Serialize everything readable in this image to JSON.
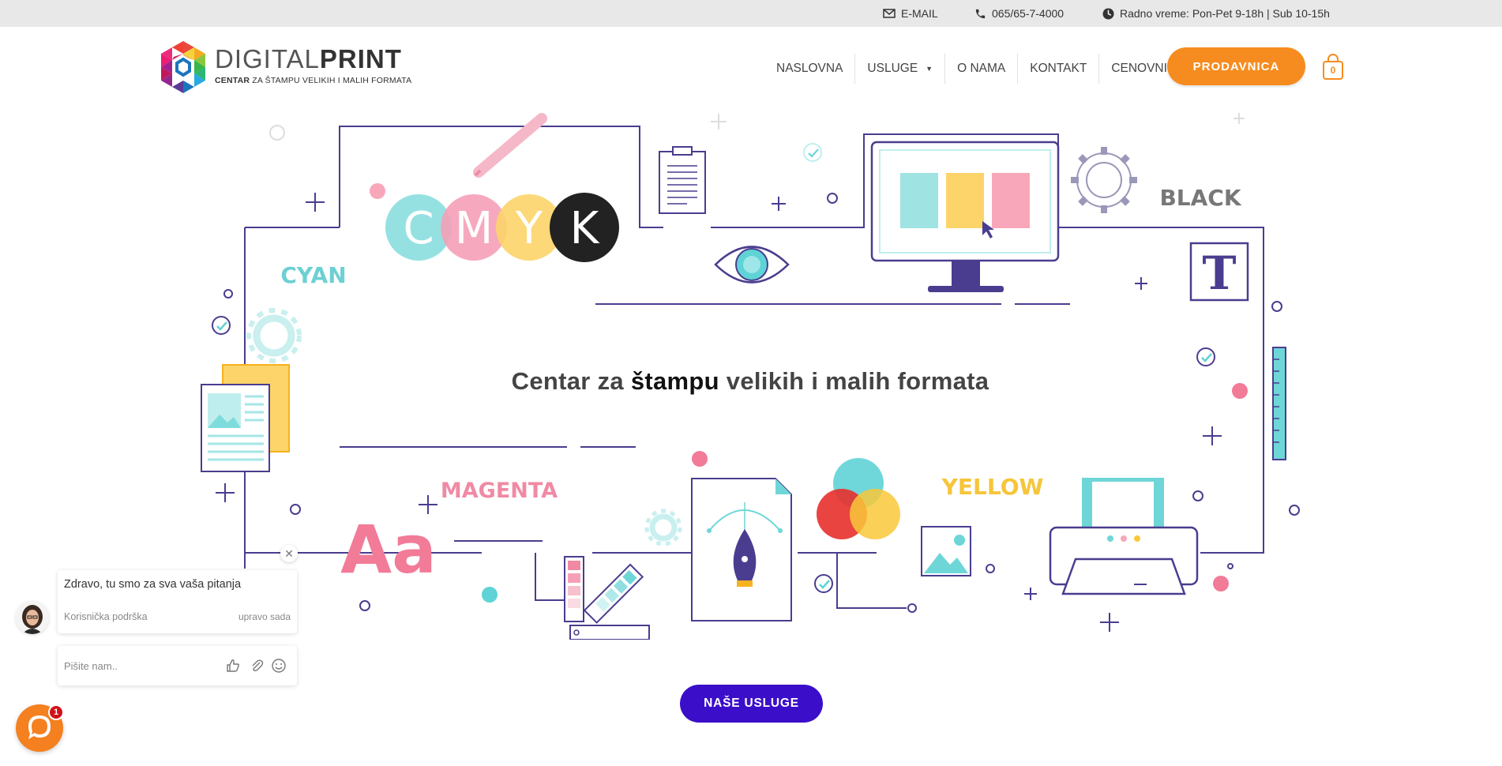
{
  "topbar": {
    "email_label": "E-MAIL",
    "phone_label": "065/65-7-4000",
    "hours_label": "Radno vreme: Pon-Pet 9-18h | Sub 10-15h"
  },
  "logo": {
    "name_light": "DIGITAL",
    "name_bold": "PRINT",
    "tagline_bold": "CENTAR",
    "tagline_rest": " ZA ŠTAMPU VELIKIH I MALIH FORMATA"
  },
  "nav": {
    "items": [
      {
        "label": "NASLOVNA"
      },
      {
        "label": "USLUGE"
      },
      {
        "label": "O NAMA"
      },
      {
        "label": "KONTAKT"
      },
      {
        "label": "CENOVNIK"
      }
    ],
    "shop_label": "PRODAVNICA",
    "cart_count": "0"
  },
  "hero": {
    "title_pre": "Centar za ",
    "title_bold": "štampu",
    "title_post": " velikih i malih formata",
    "cmyk_letters": [
      "C",
      "M",
      "Y",
      "K"
    ],
    "label_cyan": "CYAN",
    "label_magenta": "MAGENTA",
    "label_yellow": "YELLOW",
    "label_black": "BLACK",
    "typeface_sample": "Aa",
    "type_tool": "T",
    "cta_label": "NAŠE USLUGE"
  },
  "chat": {
    "greeting": "Zdravo, tu smo za sva vaša pitanja",
    "agent_label": "Korisnička podrška",
    "time_label": "upravo sada",
    "input_placeholder": "Pišite nam..",
    "badge_count": "1"
  },
  "colors": {
    "accent_orange": "#f68c1f",
    "cta_purple": "#3b0fc9",
    "line_purple": "#4a3d8f",
    "cyan": "#5fd3d6",
    "magenta": "#f0839f",
    "yellow": "#f9c83a"
  }
}
